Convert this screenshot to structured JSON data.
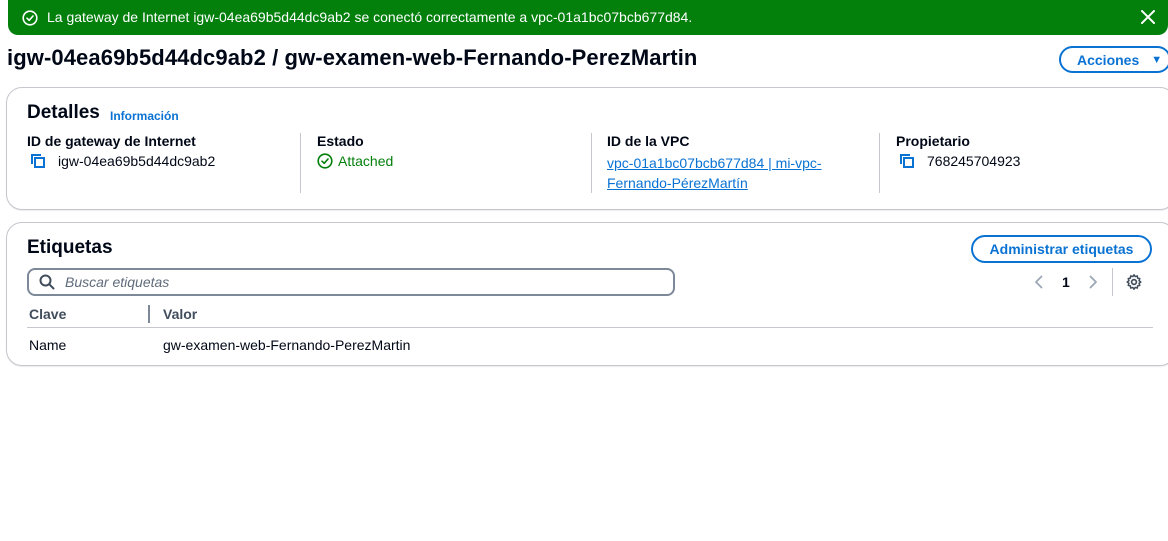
{
  "flash": {
    "message": "La gateway de Internet igw-04ea69b5d44dc9ab2 se conectó correctamente a vpc-01a1bc07bcb677d84."
  },
  "header": {
    "title": "igw-04ea69b5d44dc9ab2 / gw-examen-web-Fernando-PerezMartin",
    "actions_label": "Acciones"
  },
  "details": {
    "heading": "Detalles",
    "info_link": "Información",
    "gateway_id_label": "ID de gateway de Internet",
    "gateway_id": "igw-04ea69b5d44dc9ab2",
    "state_label": "Estado",
    "state": "Attached",
    "vpc_label": "ID de la VPC",
    "vpc_value": "vpc-01a1bc07bcb677d84 | mi-vpc-Fernando-PérezMartín",
    "owner_label": "Propietario",
    "owner": "768245704923"
  },
  "tags": {
    "heading": "Etiquetas",
    "manage_label": "Administrar etiquetas",
    "search_placeholder": "Buscar etiquetas",
    "page": "1",
    "columns": [
      "Clave",
      "Valor"
    ],
    "rows": [
      {
        "key": "Name",
        "value": "gw-examen-web-Fernando-PerezMartin"
      }
    ]
  },
  "colors": {
    "success": "#037f0c",
    "link": "#0972d3",
    "border": "#c6c6cd"
  },
  "icons": [
    "check-circle-icon",
    "close-icon",
    "copy-icon",
    "search-icon",
    "chevron-left-icon",
    "chevron-right-icon",
    "gear-icon",
    "caret-down-icon"
  ]
}
